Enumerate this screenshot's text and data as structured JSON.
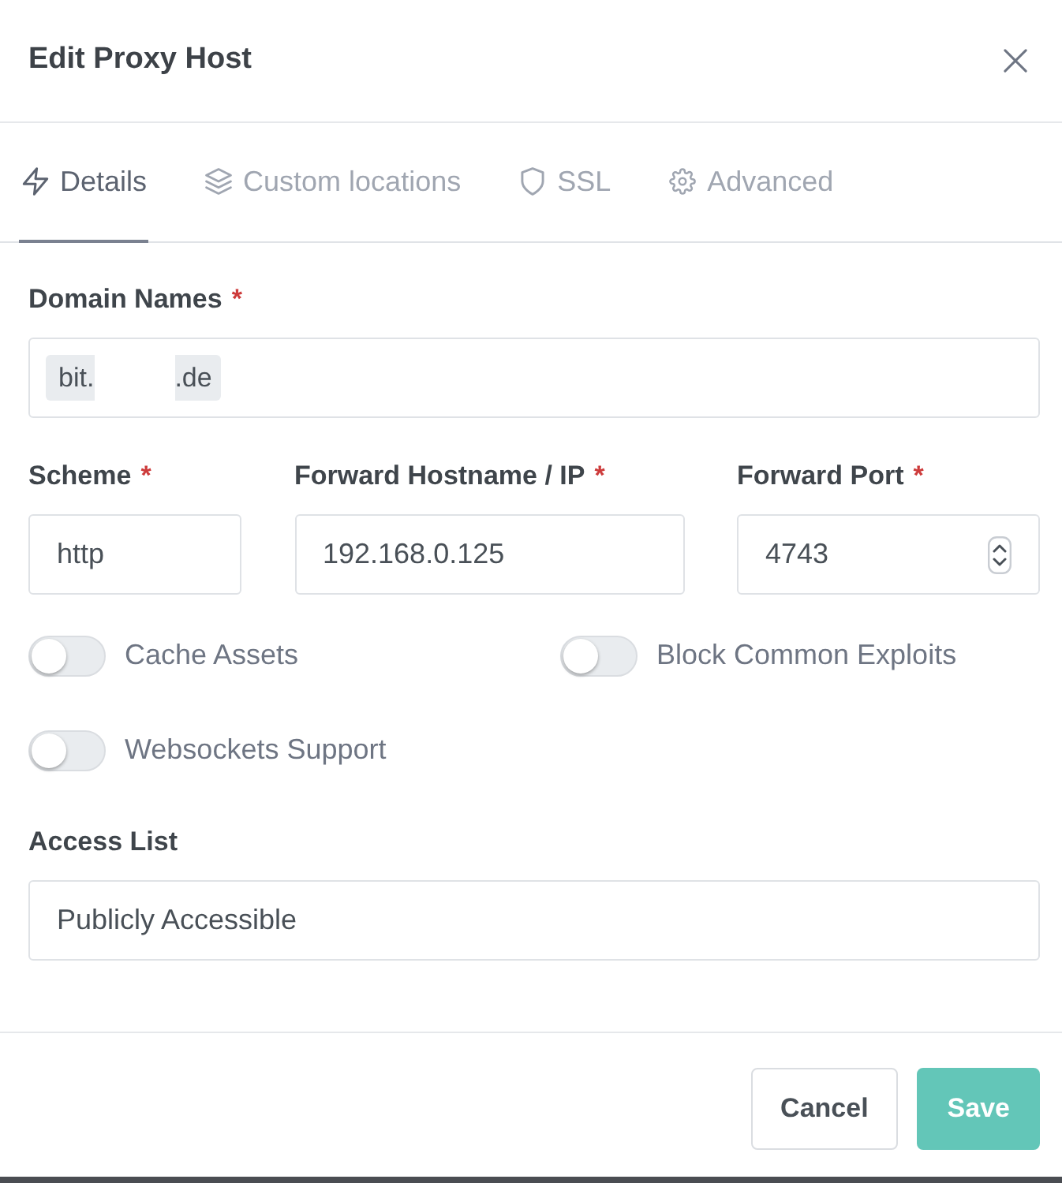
{
  "dialog": {
    "title": "Edit Proxy Host"
  },
  "tabs": [
    {
      "label": "Details",
      "selected": true
    },
    {
      "label": "Custom locations",
      "selected": false
    },
    {
      "label": "SSL",
      "selected": false
    },
    {
      "label": "Advanced",
      "selected": false
    }
  ],
  "domain_names": {
    "label": "Domain Names",
    "required_mark": "*",
    "tags": [
      {
        "prefix": "bit.",
        "redacted": true,
        "suffix": ".de"
      }
    ]
  },
  "forward": [
    {
      "label": "Scheme",
      "required_mark": "*",
      "value": "http",
      "kind": "text"
    },
    {
      "label": "Forward Hostname / IP",
      "required_mark": "*",
      "value": "192.168.0.125",
      "kind": "text"
    },
    {
      "label": "Forward Port",
      "required_mark": "*",
      "value": "4743",
      "kind": "number"
    }
  ],
  "toggles": [
    {
      "label": "Cache Assets",
      "on": false
    },
    {
      "label": "Block Common Exploits",
      "on": false
    },
    {
      "label": "Websockets Support",
      "on": false
    }
  ],
  "access_list": {
    "label": "Access List",
    "value": "Publicly Accessible"
  },
  "buttons": [
    {
      "label": "Cancel",
      "kind": "secondary"
    },
    {
      "label": "Save",
      "kind": "primary"
    }
  ]
}
